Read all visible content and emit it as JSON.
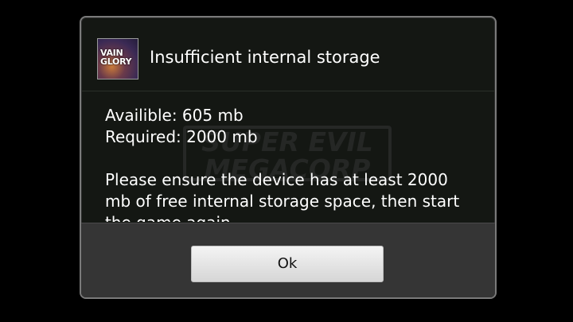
{
  "dialog": {
    "title": "Insufficient internal storage",
    "app_icon": {
      "name": "vainglory-app-icon",
      "logo_line1": "VAIN",
      "logo_line2": "GLORY"
    },
    "watermark": {
      "line1": "SUPER EVIL",
      "line2": "MEGACORP"
    },
    "message": {
      "available": "Availible: 605 mb",
      "required": "Required: 2000 mb",
      "body_line1": "Please ensure the device has at least 2000",
      "body_line2": "mb of free internal storage space, then start",
      "body_line3": "the game again."
    },
    "ok_label": "Ok"
  },
  "colors": {
    "background": "#000000",
    "dialog_bg": "#141713",
    "button_bar_bg": "#353535",
    "button_bg": "#e6e6e6"
  }
}
